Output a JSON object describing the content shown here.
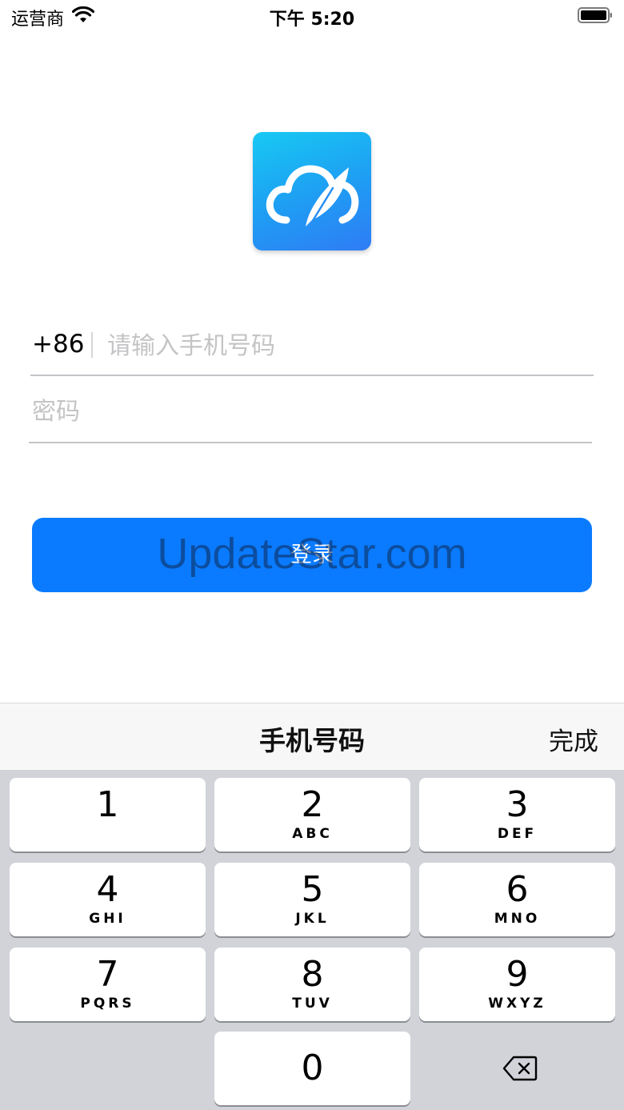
{
  "status_bar": {
    "carrier": "运营商",
    "time": "下午 5:20"
  },
  "form": {
    "country_code": "+86",
    "phone_placeholder": "请输入手机号码",
    "password_placeholder": "密码",
    "login_label": "登录"
  },
  "watermark": "UpdateStar.com",
  "keyboard": {
    "title": "手机号码",
    "done_label": "完成",
    "keys": [
      {
        "digit": "1",
        "letters": ""
      },
      {
        "digit": "2",
        "letters": "ABC"
      },
      {
        "digit": "3",
        "letters": "DEF"
      },
      {
        "digit": "4",
        "letters": "GHI"
      },
      {
        "digit": "5",
        "letters": "JKL"
      },
      {
        "digit": "6",
        "letters": "MNO"
      },
      {
        "digit": "7",
        "letters": "PQRS"
      },
      {
        "digit": "8",
        "letters": "TUV"
      },
      {
        "digit": "9",
        "letters": "WXYZ"
      },
      {
        "digit": "0",
        "letters": ""
      }
    ],
    "delete_icon": "delete-backspace-icon"
  },
  "icons": {
    "wifi": "wifi-icon",
    "battery": "battery-icon",
    "logo": "cloud-feather-logo"
  },
  "colors": {
    "primary": "#0a7bff",
    "keypad_bg": "#d1d3d9"
  }
}
